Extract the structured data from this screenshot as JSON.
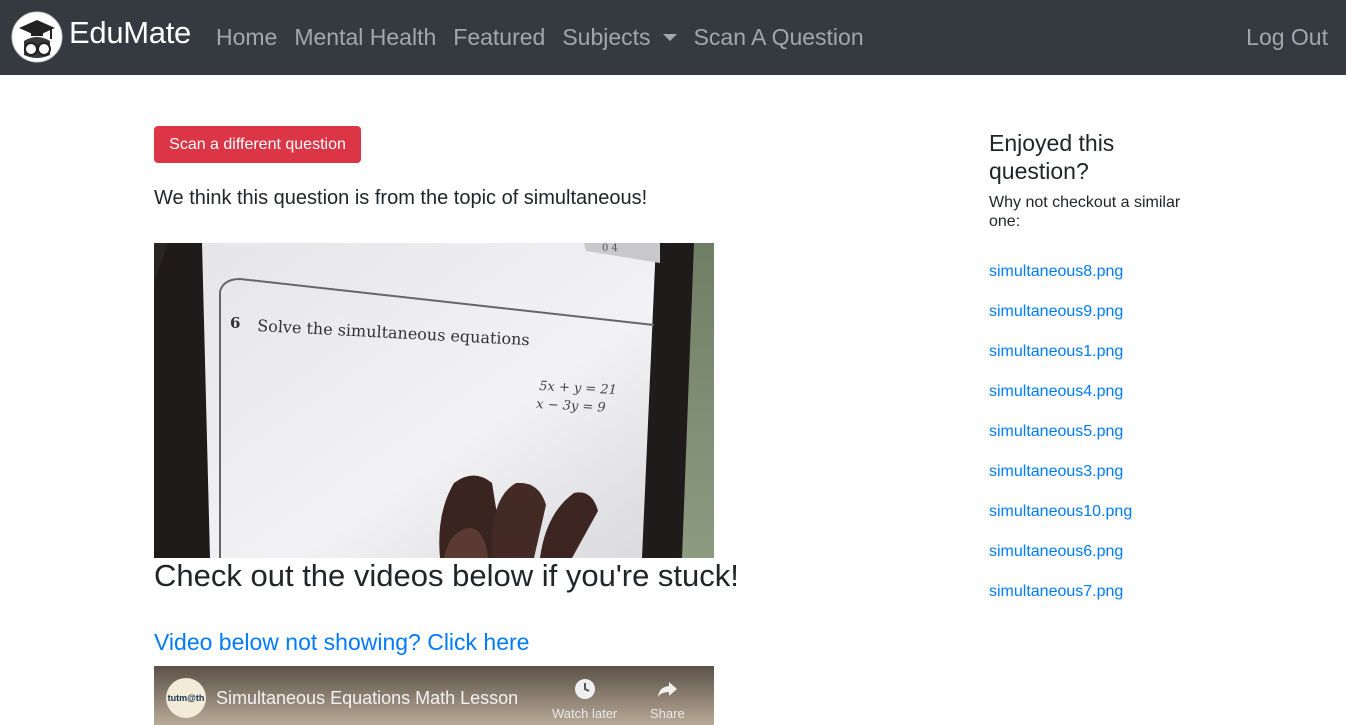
{
  "navbar": {
    "brand": "EduMate",
    "links": [
      {
        "label": "Home"
      },
      {
        "label": "Mental Health"
      },
      {
        "label": "Featured"
      },
      {
        "label": "Subjects",
        "dropdown": true
      },
      {
        "label": "Scan A Question"
      }
    ],
    "logout": "Log Out",
    "colors": {
      "background": "#343a40",
      "link": "rgba(255,255,255,0.55)"
    }
  },
  "main": {
    "scan_button": "Scan a different question",
    "topic_text": "We think this question is from the topic of simultaneous!",
    "photo": {
      "question_number": "6",
      "question_text": "Solve the simultaneous equations",
      "equation_1": "5x + y = 21",
      "equation_2": "x − 3y = 9",
      "corner_digits": "0  4"
    },
    "videos_heading": "Check out the videos below if you're stuck!",
    "video_link": "Video below not showing? Click here",
    "video": {
      "channel_badge": "tutm@th",
      "title": "Simultaneous Equations Math Lesson",
      "watch_later": "Watch later",
      "share": "Share"
    }
  },
  "sidebar": {
    "title": "Enjoyed this question?",
    "subtitle": "Why not checkout a similar one:",
    "items": [
      "simultaneous8.png",
      "simultaneous9.png",
      "simultaneous1.png",
      "simultaneous4.png",
      "simultaneous5.png",
      "simultaneous3.png",
      "simultaneous10.png",
      "simultaneous6.png",
      "simultaneous7.png"
    ]
  },
  "colors": {
    "danger": "#dc3545",
    "link": "#007bff",
    "text": "#212529"
  }
}
